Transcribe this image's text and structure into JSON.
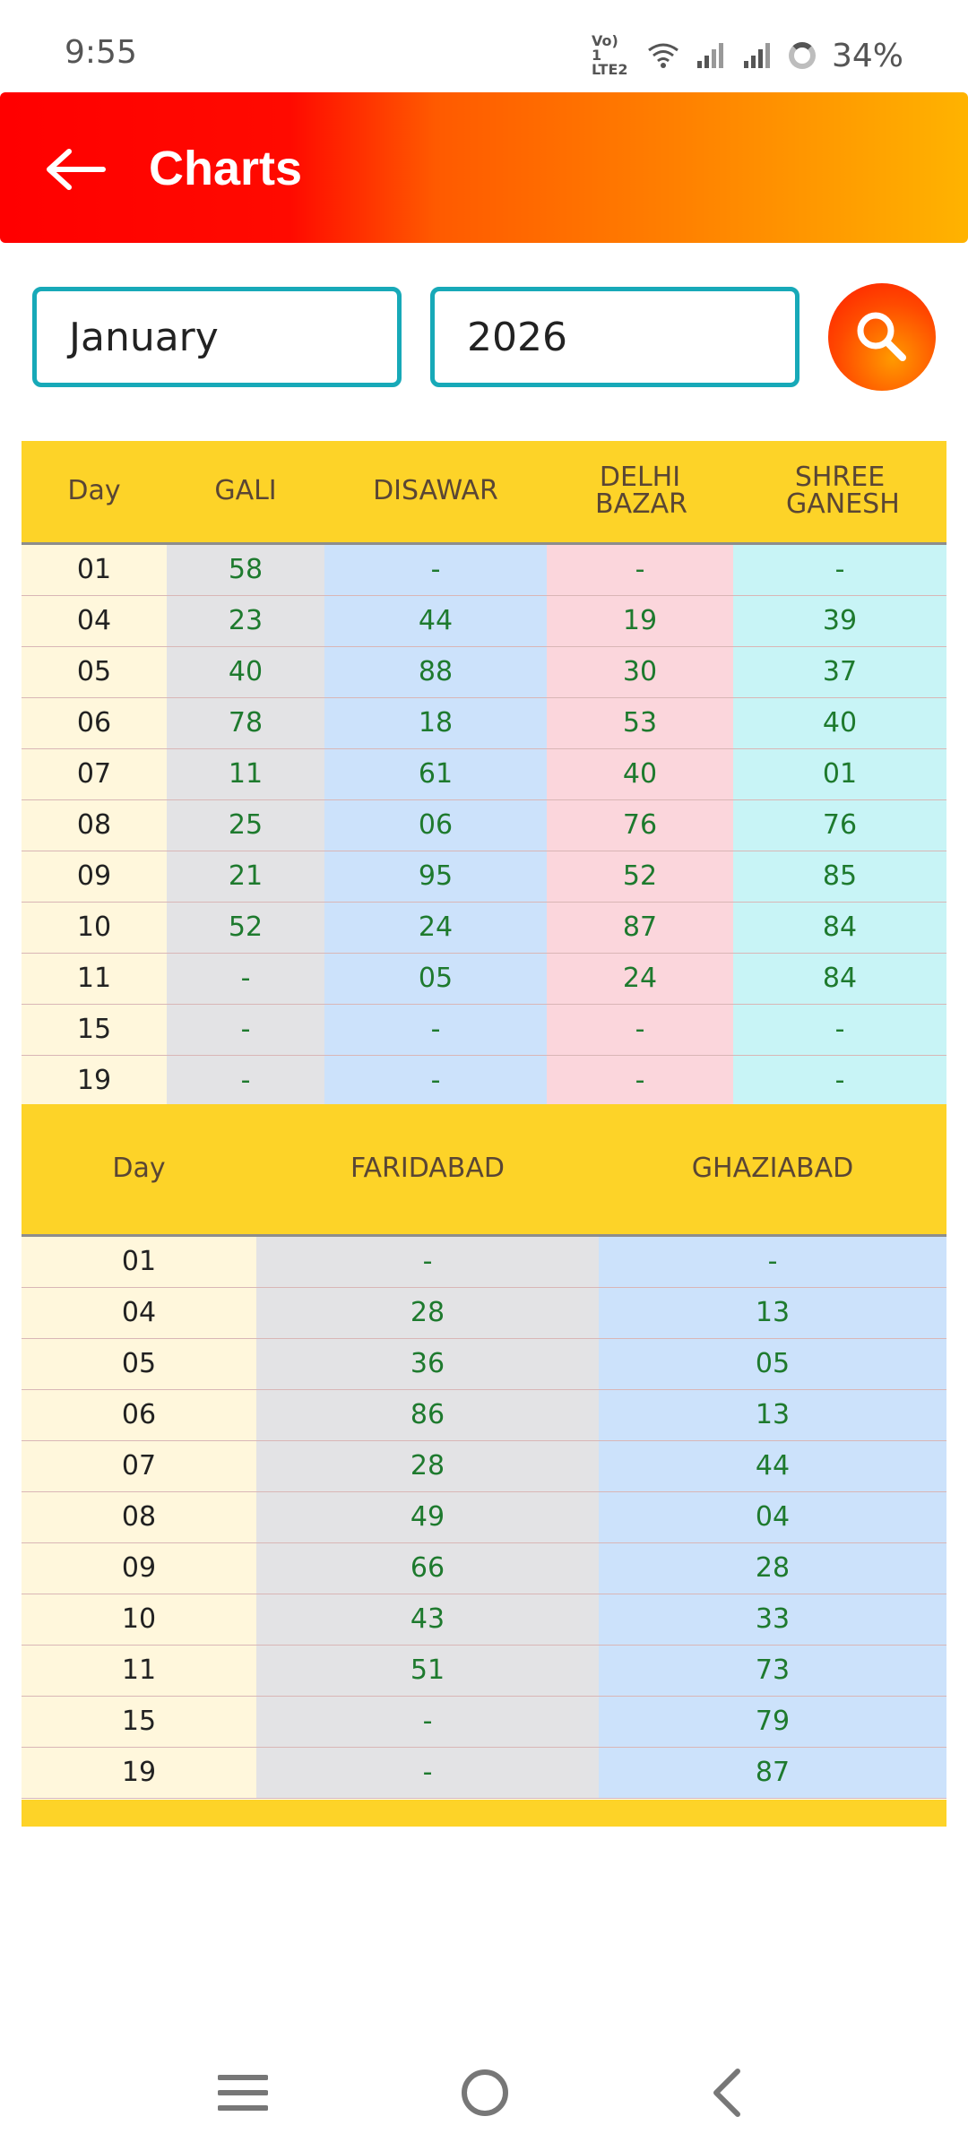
{
  "status_bar": {
    "time": "9:55",
    "volte_line1": "Vo) 1",
    "volte_line2": "LTE2",
    "battery": "34%",
    "icons": [
      "wifi-icon",
      "signal-icon",
      "signal-icon",
      "battery-ring-icon"
    ]
  },
  "header": {
    "title": "Charts",
    "back_icon": "arrow-left-icon",
    "gradient": [
      "#ff0000",
      "#ff8000",
      "#ffb300"
    ]
  },
  "filters": {
    "month": "January",
    "year": "2026",
    "search_icon": "search-icon"
  },
  "table1": {
    "headers": [
      "Day",
      "GALI",
      "DISAWAR",
      "DELHI BAZAR",
      "SHREE GANESH"
    ],
    "rows": [
      [
        "01",
        "58",
        "-",
        "-",
        "-"
      ],
      [
        "04",
        "23",
        "44",
        "19",
        "39"
      ],
      [
        "05",
        "40",
        "88",
        "30",
        "37"
      ],
      [
        "06",
        "78",
        "18",
        "53",
        "40"
      ],
      [
        "07",
        "11",
        "61",
        "40",
        "01"
      ],
      [
        "08",
        "25",
        "06",
        "76",
        "76"
      ],
      [
        "09",
        "21",
        "95",
        "52",
        "85"
      ],
      [
        "10",
        "52",
        "24",
        "87",
        "84"
      ],
      [
        "11",
        "-",
        "05",
        "24",
        "84"
      ],
      [
        "15",
        "-",
        "-",
        "-",
        "-"
      ],
      [
        "19",
        "-",
        "-",
        "-",
        "-"
      ]
    ]
  },
  "table2": {
    "headers": [
      "Day",
      "FARIDABAD",
      "GHAZIABAD"
    ],
    "rows": [
      [
        "01",
        "-",
        "-"
      ],
      [
        "04",
        "28",
        "13"
      ],
      [
        "05",
        "36",
        "05"
      ],
      [
        "06",
        "86",
        "13"
      ],
      [
        "07",
        "28",
        "44"
      ],
      [
        "08",
        "49",
        "04"
      ],
      [
        "09",
        "66",
        "28"
      ],
      [
        "10",
        "43",
        "33"
      ],
      [
        "11",
        "51",
        "73"
      ],
      [
        "15",
        "-",
        "79"
      ],
      [
        "19",
        "-",
        "87"
      ]
    ]
  },
  "colors": {
    "header_yellow": "#fdd328",
    "day_col": "#fff7dc",
    "grey": "#e3e3e5",
    "blue": "#cce2fb",
    "pink": "#fbd6dc",
    "cyan": "#c8f4f6",
    "value_text": "#1e7a2e",
    "input_border": "#17a9b8"
  },
  "navbar": {
    "items": [
      "menu-icon",
      "home-icon",
      "back-icon"
    ]
  }
}
